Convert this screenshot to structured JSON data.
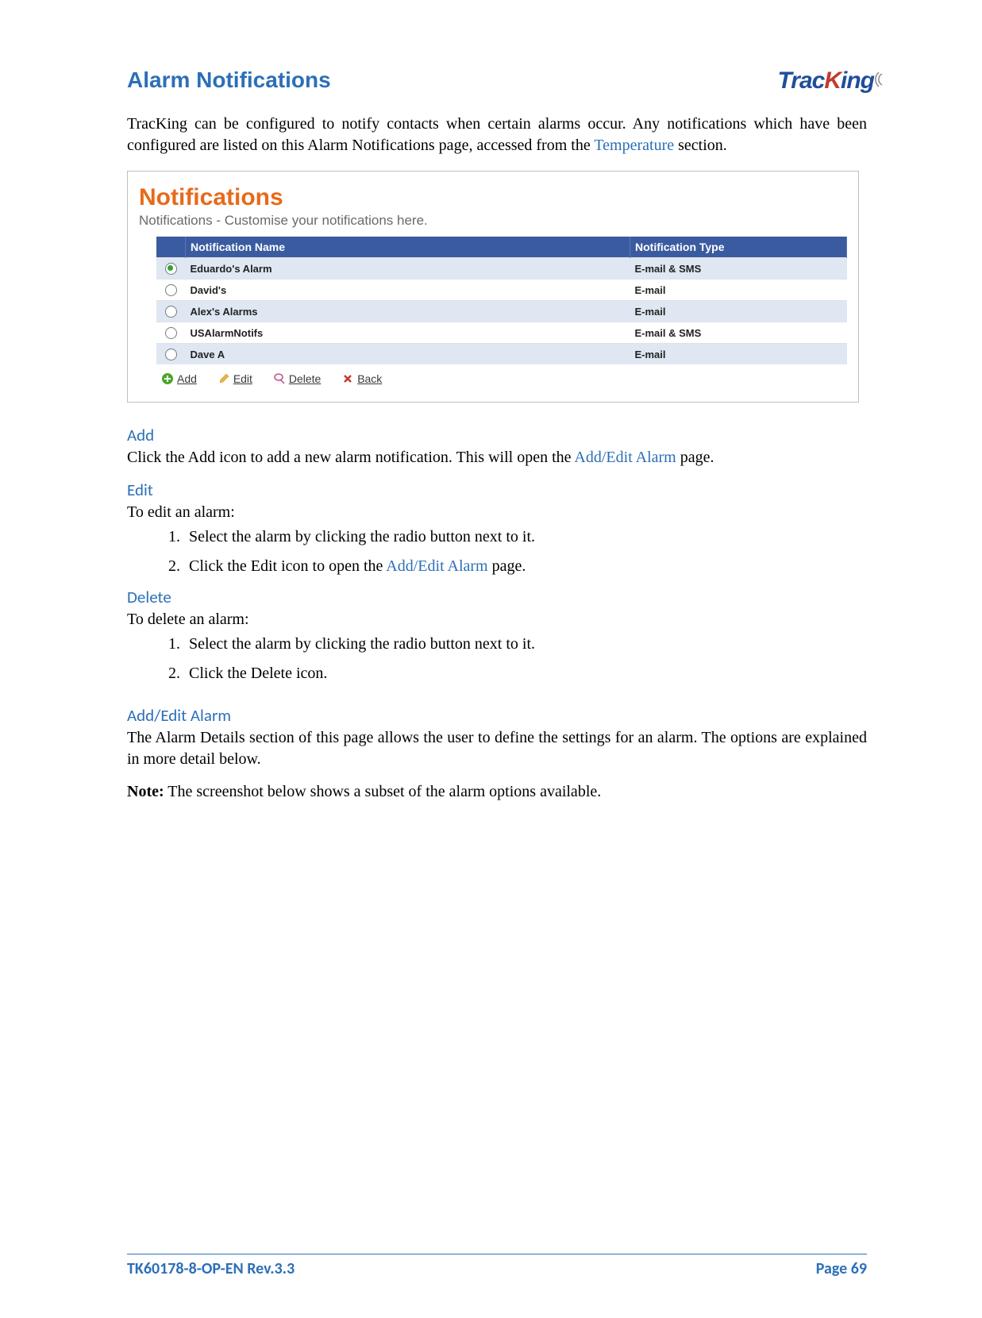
{
  "logo": {
    "part1": "Trac",
    "part2": "K",
    "part3": "ing"
  },
  "title": "Alarm Notifications",
  "intro": {
    "text_before_link": "TracKing can be configured to notify contacts when certain alarms occur. Any notifications which have been configured are listed on this Alarm Notifications page, accessed from the ",
    "link": "Temperature",
    "text_after_link": " section."
  },
  "screenshot": {
    "heading": "Notifications",
    "subheading": "Notifications - Customise your notifications here.",
    "columns": {
      "name": "Notification Name",
      "type": "Notification Type"
    },
    "rows": [
      {
        "selected": true,
        "name": "Eduardo's Alarm",
        "type": "E-mail & SMS",
        "alt": true
      },
      {
        "selected": false,
        "name": "David's",
        "type": "E-mail",
        "alt": false
      },
      {
        "selected": false,
        "name": "Alex's Alarms",
        "type": "E-mail",
        "alt": true
      },
      {
        "selected": false,
        "name": "USAlarmNotifs",
        "type": "E-mail & SMS",
        "alt": false
      },
      {
        "selected": false,
        "name": "Dave A",
        "type": "E-mail",
        "alt": true
      }
    ],
    "toolbar": {
      "add": "Add",
      "edit": "Edit",
      "delete": "Delete",
      "back": "Back"
    }
  },
  "sections": {
    "add": {
      "heading": "Add",
      "text_before_link": "Click the Add icon to add a new alarm notification. This will open the ",
      "link": "Add/Edit Alarm",
      "text_after_link": " page."
    },
    "edit": {
      "heading": "Edit",
      "intro": "To edit an alarm:",
      "steps": [
        "Select the alarm by clicking the radio button next to it.",
        {
          "before": "Click the Edit icon to open the ",
          "link": "Add/Edit Alarm",
          "after": " page."
        }
      ]
    },
    "delete": {
      "heading": "Delete",
      "intro": "To delete an alarm:",
      "steps": [
        "Select the alarm by clicking the radio button next to it.",
        "Click the Delete icon."
      ]
    },
    "addedit": {
      "heading": "Add/Edit Alarm",
      "para": "The Alarm Details section of this page allows the user to define the settings for an alarm. The options are explained in more detail below.",
      "note_label": "Note:",
      "note_text": " The screenshot below shows a subset of the alarm options available."
    }
  },
  "footer": {
    "left": "TK60178-8-OP-EN Rev.3.3",
    "right_label": "Page ",
    "page": "69"
  }
}
